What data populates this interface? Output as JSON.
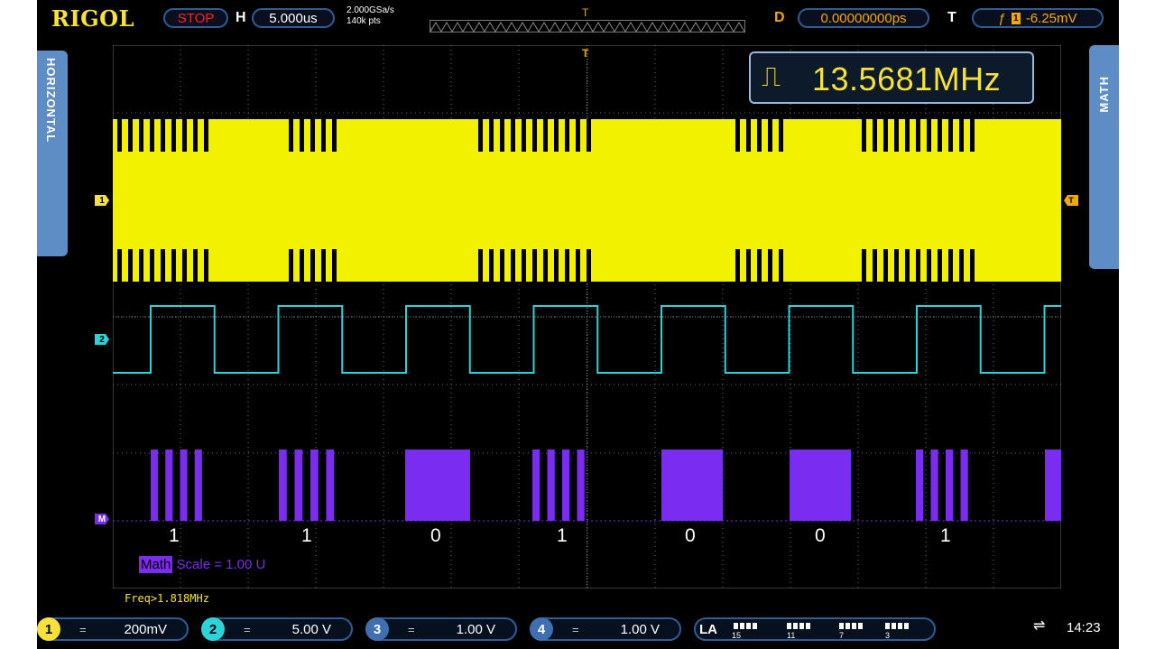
{
  "topbar": {
    "brand": "RIGOL",
    "run_state": "STOP",
    "h_label": "H",
    "timebase": "5.000us",
    "sample_rate": "2.000GSa/s",
    "mem_depth": "140k pts",
    "trigger_marker": "T",
    "d_label": "D",
    "delay": "0.00000000ps",
    "t_label": "T",
    "trigger_level": "-6.25mV"
  },
  "side": {
    "left_label": "HORIZONTAL",
    "right_label": "MATH"
  },
  "measurement": {
    "frequency": "13.5681MHz",
    "icon": "square-pulse-icon"
  },
  "channel_markers": {
    "ch1": "1",
    "ch2": "2",
    "math": "M",
    "trigger": "T"
  },
  "decoded_bits": [
    "1",
    "1",
    "0",
    "1",
    "0",
    "0",
    "1"
  ],
  "math_scale": {
    "tag": "Math",
    "text": "Scale = 1.00 U"
  },
  "freq_line": "Freq>1.818MHz",
  "bottombar": {
    "channels": [
      {
        "num": "1",
        "coupling": "=",
        "scale": "200mV",
        "color": "#f7e23a"
      },
      {
        "num": "2",
        "coupling": "=",
        "scale": "5.00 V",
        "color": "#2cd3d9"
      },
      {
        "num": "3",
        "coupling": "=",
        "scale": "1.00 V",
        "color": "#3f6fb0"
      },
      {
        "num": "4",
        "coupling": "=",
        "scale": "1.00 V",
        "color": "#3f6fb0"
      }
    ],
    "la": {
      "tag": "LA",
      "labels": [
        "15",
        "11",
        "7",
        "3"
      ]
    },
    "usb_icon": "usb-icon",
    "time": "14:23"
  },
  "colors": {
    "ch1": "#f7e23a",
    "ch2": "#2cd3d9",
    "math": "#7a2cf0",
    "accent_orange": "#f2a900",
    "panel_blue": "#5d8dc4"
  }
}
